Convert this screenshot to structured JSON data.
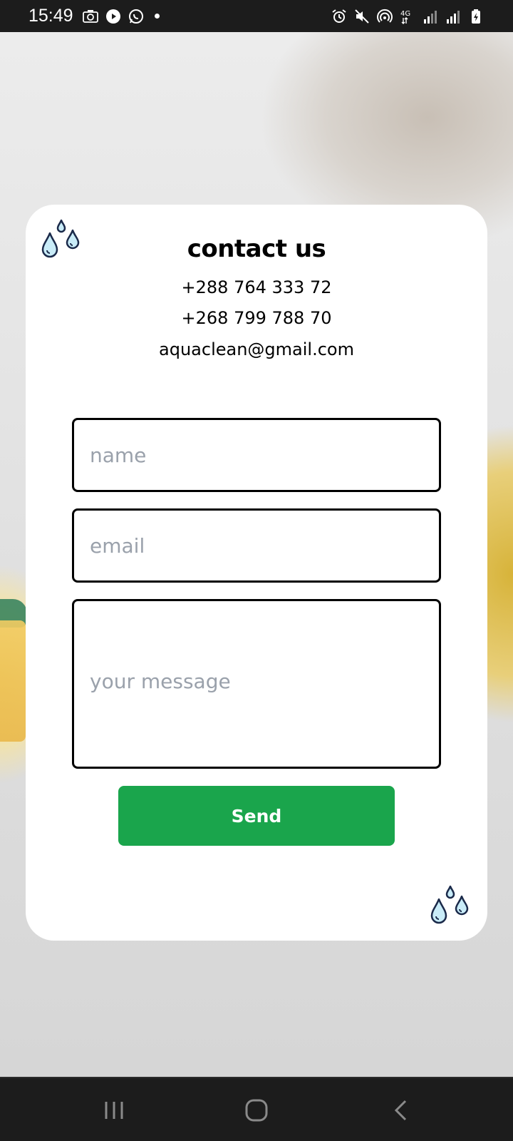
{
  "status_bar": {
    "time": "15:49",
    "left_icons": [
      "camera-icon",
      "play-icon",
      "whatsapp-icon",
      "dot-icon"
    ],
    "right_icons": [
      "alarm-icon",
      "mute-icon",
      "hotspot-icon",
      "network-4g-icon",
      "signal-icon",
      "signal-icon",
      "battery-charging-icon"
    ],
    "network_label": "4G"
  },
  "card": {
    "title": "contact us",
    "phone_1": "+288 764 333 72",
    "phone_2": "+268 799 788 70",
    "email": "aquaclean@gmail.com"
  },
  "form": {
    "name_placeholder": "name",
    "email_placeholder": "email",
    "message_placeholder": "your message",
    "send_label": "Send"
  },
  "nav_bar": {
    "buttons": [
      "recent-apps-icon",
      "home-icon",
      "back-icon"
    ]
  },
  "colors": {
    "accent": "#1aa54c",
    "drop_fill": "#c9ecf8",
    "drop_stroke": "#1b2a4a"
  }
}
